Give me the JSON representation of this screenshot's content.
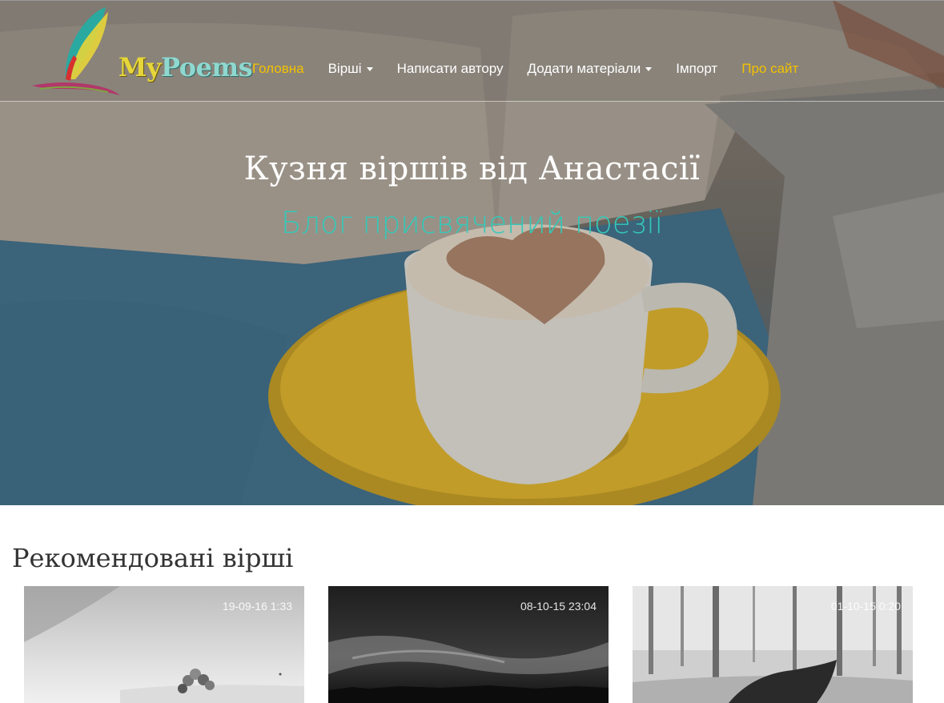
{
  "logo": {
    "my": "My",
    "poems": "Poems"
  },
  "nav": {
    "items": [
      {
        "label": "Головна",
        "active": true,
        "dropdown": false
      },
      {
        "label": "Вірші",
        "active": false,
        "dropdown": true
      },
      {
        "label": "Написати автору",
        "active": false,
        "dropdown": false
      },
      {
        "label": "Додати матеріали",
        "active": false,
        "dropdown": true
      },
      {
        "label": "Імпорт",
        "active": false,
        "dropdown": false
      },
      {
        "label": "Про сайт",
        "active": true,
        "dropdown": false
      }
    ]
  },
  "hero": {
    "title": "Кузня віршів від Анастасії",
    "subtitle": "Блог присвячений поезії"
  },
  "featured": {
    "heading": "Рекомендовані вірші",
    "cards": [
      {
        "date": "19-09-16 1:33"
      },
      {
        "date": "08-10-15 23:04"
      },
      {
        "date": "01-10-15 0:20"
      }
    ]
  },
  "colors": {
    "nav_active": "#f2c200",
    "subtitle": "#34c9b8",
    "saucer": "#e3b62a"
  }
}
